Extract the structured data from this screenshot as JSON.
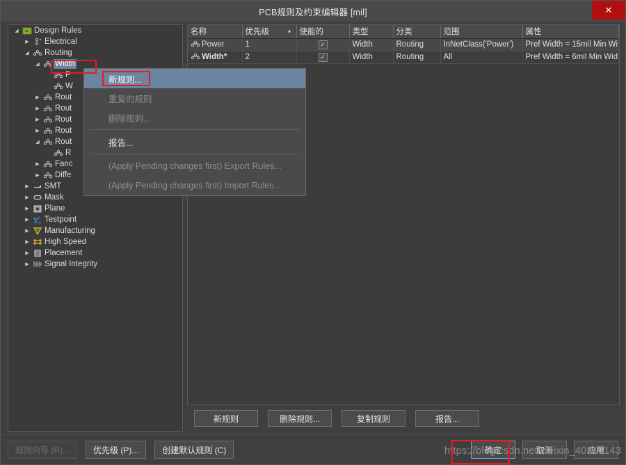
{
  "window": {
    "title": "PCB规则及约束编辑器 [mil]",
    "close_label": "✕"
  },
  "tree": {
    "items": [
      {
        "label": "Design Rules",
        "indent": 0,
        "arrow": "down",
        "icon": "design-rules-icon"
      },
      {
        "label": "Electrical",
        "indent": 1,
        "arrow": "right",
        "icon": "electrical-icon"
      },
      {
        "label": "Routing",
        "indent": 1,
        "arrow": "down",
        "icon": "routing-icon"
      },
      {
        "label": "Width",
        "indent": 2,
        "arrow": "down",
        "icon": "routing-icon",
        "selected": true
      },
      {
        "label": "P",
        "indent": 3,
        "arrow": "none",
        "icon": "routing-icon"
      },
      {
        "label": "W",
        "indent": 3,
        "arrow": "none",
        "icon": "routing-icon"
      },
      {
        "label": "Rout",
        "indent": 2,
        "arrow": "right",
        "icon": "routing-icon"
      },
      {
        "label": "Rout",
        "indent": 2,
        "arrow": "right",
        "icon": "routing-icon"
      },
      {
        "label": "Rout",
        "indent": 2,
        "arrow": "right",
        "icon": "routing-icon"
      },
      {
        "label": "Rout",
        "indent": 2,
        "arrow": "right",
        "icon": "routing-icon"
      },
      {
        "label": "Rout",
        "indent": 2,
        "arrow": "down",
        "icon": "routing-icon"
      },
      {
        "label": "R",
        "indent": 3,
        "arrow": "none",
        "icon": "routing-icon"
      },
      {
        "label": "Fanc",
        "indent": 2,
        "arrow": "right",
        "icon": "routing-icon"
      },
      {
        "label": "Diffe",
        "indent": 2,
        "arrow": "right",
        "icon": "routing-icon"
      },
      {
        "label": "SMT",
        "indent": 1,
        "arrow": "right",
        "icon": "smt-icon"
      },
      {
        "label": "Mask",
        "indent": 1,
        "arrow": "right",
        "icon": "mask-icon"
      },
      {
        "label": "Plane",
        "indent": 1,
        "arrow": "right",
        "icon": "plane-icon"
      },
      {
        "label": "Testpoint",
        "indent": 1,
        "arrow": "right",
        "icon": "testpoint-icon"
      },
      {
        "label": "Manufacturing",
        "indent": 1,
        "arrow": "right",
        "icon": "manufacturing-icon"
      },
      {
        "label": "High Speed",
        "indent": 1,
        "arrow": "right",
        "icon": "high-speed-icon"
      },
      {
        "label": "Placement",
        "indent": 1,
        "arrow": "right",
        "icon": "placement-icon"
      },
      {
        "label": "Signal Integrity",
        "indent": 1,
        "arrow": "right",
        "icon": "signal-integrity-icon"
      }
    ]
  },
  "context_menu": {
    "items": [
      {
        "label": "新规则...",
        "state": "highlighted"
      },
      {
        "label": "重复的规则",
        "state": "disabled"
      },
      {
        "label": "删除规则...",
        "state": "disabled"
      },
      {
        "separator_after": true,
        "label": "报告...",
        "state": "normal"
      },
      {
        "label": "(Apply Pending changes first) Export Rules...",
        "state": "disabled"
      },
      {
        "label": "(Apply Pending changes first) Import Rules...",
        "state": "disabled"
      }
    ]
  },
  "grid": {
    "columns": [
      {
        "label": "名称",
        "sorted": false
      },
      {
        "label": "优先级",
        "sorted": true,
        "sortmark": "▲"
      },
      {
        "label": "使能的",
        "sorted": false
      },
      {
        "label": "类型",
        "sorted": false
      },
      {
        "label": "分类",
        "sorted": false
      },
      {
        "label": "范围",
        "sorted": false
      },
      {
        "label": "属性",
        "sorted": false
      }
    ],
    "rows": [
      {
        "name": "Power",
        "name_bold": false,
        "priority": "1",
        "enabled": "✓",
        "type": "Width",
        "category": "Routing",
        "scope": "InNetClass('Power')",
        "attributes": "Pref Width = 15mil    Min Wi"
      },
      {
        "name": "Width*",
        "name_bold": true,
        "priority": "2",
        "enabled": "✓",
        "type": "Width",
        "category": "Routing",
        "scope": "All",
        "attributes": "Pref Width = 6mil    Min Wid"
      }
    ]
  },
  "mid_buttons": [
    {
      "label": "新规则",
      "disabled": false
    },
    {
      "label": "删除规则...",
      "disabled": false
    },
    {
      "label": "复制规则",
      "disabled": false
    },
    {
      "label": "报告...",
      "disabled": false
    }
  ],
  "footer": {
    "left_buttons": [
      {
        "label": "规则向导 (R)...",
        "disabled": true
      },
      {
        "label": "优先级 (P)...",
        "disabled": false
      },
      {
        "label": "创建默认规则 (C)",
        "disabled": false
      }
    ],
    "right_buttons": [
      {
        "label": "确定",
        "focused": true
      },
      {
        "label": "取消",
        "focused": false
      },
      {
        "label": "应用",
        "focused": false
      }
    ]
  },
  "watermark": {
    "text": "https://blog.csdn.net/weixin_40315143"
  },
  "colors": {
    "window_bg": "#3f3f3f",
    "titlebar_bg": "#4a4a4a",
    "panel_bg": "#3a3a3a",
    "header_bg": "#4a4a4a",
    "selection": "#6b84a0",
    "close_red": "#b01010",
    "annotation_red": "#e81c1c",
    "text": "#e0e0e0"
  }
}
